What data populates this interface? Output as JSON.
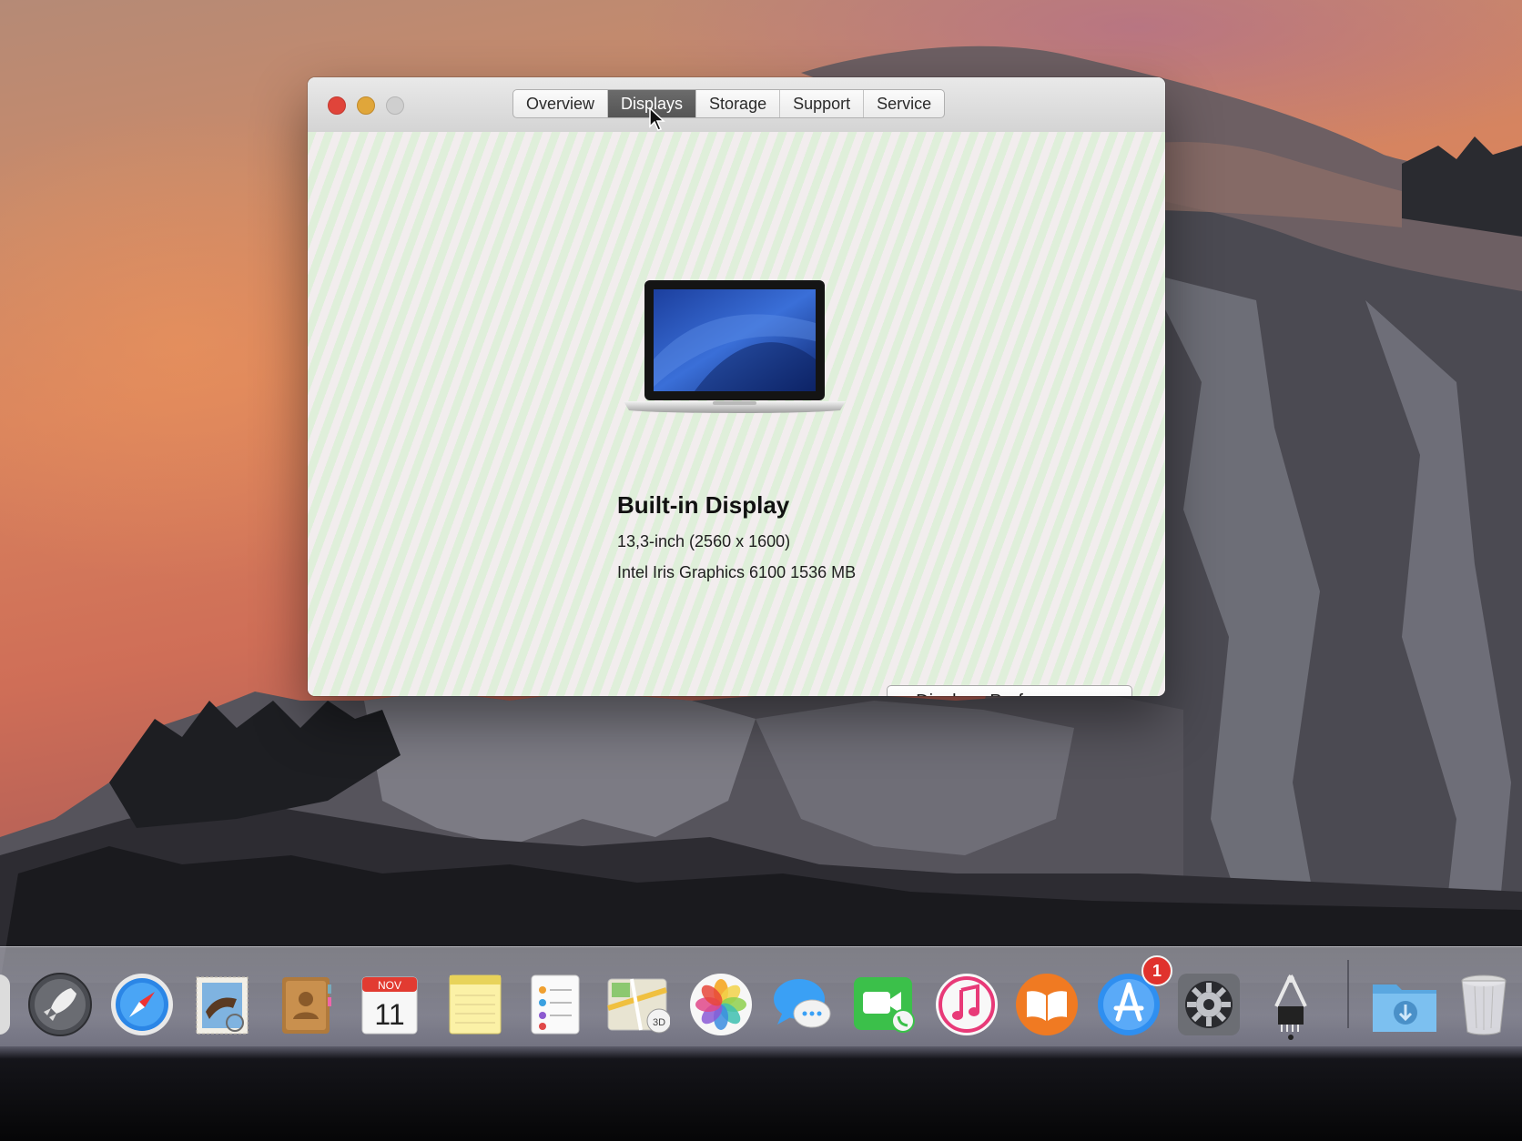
{
  "window": {
    "tabs": [
      {
        "label": "Overview"
      },
      {
        "label": "Displays"
      },
      {
        "label": "Storage"
      },
      {
        "label": "Support"
      },
      {
        "label": "Service"
      }
    ],
    "active_tab": "Displays"
  },
  "display": {
    "title": "Built-in Display",
    "size": "13,3-inch (2560 x 1600)",
    "graphics": "Intel Iris Graphics 6100 1536 MB",
    "preferences_button": "Displays Preferences..."
  },
  "dock": {
    "items": [
      {
        "name": "Launchpad",
        "icon": "rocket-icon"
      },
      {
        "name": "Safari",
        "icon": "compass-icon"
      },
      {
        "name": "Mail",
        "icon": "stamp-icon"
      },
      {
        "name": "Contacts",
        "icon": "address-book-icon"
      },
      {
        "name": "Calendar",
        "icon": "calendar-icon",
        "month": "NOV",
        "day": "11"
      },
      {
        "name": "Notes",
        "icon": "notepad-icon"
      },
      {
        "name": "Reminders",
        "icon": "checklist-icon"
      },
      {
        "name": "Maps",
        "icon": "map-icon",
        "label": "3D"
      },
      {
        "name": "Photos",
        "icon": "pinwheel-icon"
      },
      {
        "name": "Messages",
        "icon": "speech-bubble-icon"
      },
      {
        "name": "FaceTime",
        "icon": "video-camera-icon"
      },
      {
        "name": "iTunes",
        "icon": "music-note-icon"
      },
      {
        "name": "iBooks",
        "icon": "open-book-icon"
      },
      {
        "name": "App Store",
        "icon": "app-store-icon",
        "badge": "1"
      },
      {
        "name": "System Preferences",
        "icon": "gear-icon"
      },
      {
        "name": "System Information",
        "icon": "chip-caliper-icon"
      },
      {
        "name": "Downloads",
        "icon": "downloads-folder-icon"
      },
      {
        "name": "Trash",
        "icon": "trash-icon"
      }
    ]
  },
  "colors": {
    "close": "#e0443a",
    "minimize": "#e0a63a",
    "badge": "#e0322d",
    "active_tab": "#5f5f5f"
  }
}
